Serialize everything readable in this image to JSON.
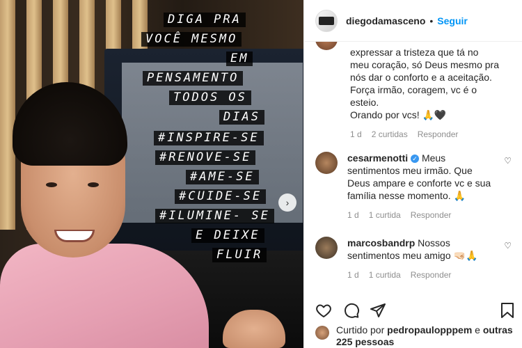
{
  "post": {
    "overlay_lines": [
      "DIGA PRA",
      "VOCÊ MESMO",
      "EM",
      "PENSAMENTO",
      "TODOS OS",
      "DIAS",
      "#INSPIRE-SE",
      "#RENOVE-SE",
      "#AME-SE",
      "#CUIDE-SE",
      "#ILUMINE- SE",
      "E DEIXE",
      "FLUIR"
    ]
  },
  "header": {
    "username": "diegodamasceno",
    "separator": "•",
    "follow_label": "Seguir"
  },
  "comments": {
    "top": {
      "text_lines": [
        "expressar a tristeza que tá no",
        "meu coração, só Deus mesmo pra",
        "nós dar o conforto e a aceitação.",
        "Força irmão, coragem, vc é o",
        "esteio.",
        "Orando por vcs! 🙏🖤"
      ],
      "time": "1 d",
      "likes": "2 curtidas",
      "reply": "Responder"
    },
    "items": [
      {
        "user": "cesarmenotti",
        "text": "Meus sentimentos meu irmão. Que Deus ampare e conforte vc e sua família nesse momento. 🙏",
        "time": "1 d",
        "likes": "1 curtida",
        "reply": "Responder"
      },
      {
        "user": "marcosbandrp",
        "text": "Nossos sentimentos meu amigo 🤜🏻🙏",
        "time": "1 d",
        "likes": "1 curtida",
        "reply": "Responder"
      }
    ]
  },
  "likes": {
    "prefix": "Curtido por",
    "user": "pedropaulopppem",
    "conj": "e",
    "others": "outras 225 pessoas"
  },
  "colors": {
    "accent": "#0095f6",
    "verified": "#3897f0",
    "muted": "#8e8e8e"
  }
}
